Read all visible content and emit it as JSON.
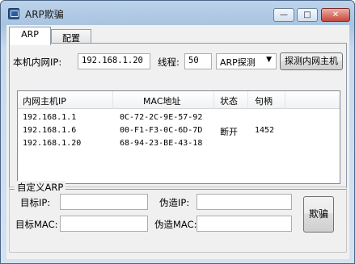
{
  "window": {
    "title": "ARP欺骗",
    "minimize": "—",
    "maximize": "□",
    "close": "✕"
  },
  "tabs": [
    {
      "label": "ARP",
      "active": true
    },
    {
      "label": "配置",
      "active": false
    }
  ],
  "scan": {
    "ip_label": "本机内网IP:",
    "ip_value": "192.168.1.20",
    "threads_label": "线程:",
    "threads_value": "50",
    "mode_value": "ARP探测",
    "scan_button": "探测内网主机"
  },
  "hosts_table": {
    "columns": [
      "内网主机IP",
      "MAC地址",
      "状态",
      "句柄"
    ],
    "rows": [
      {
        "ip": "192.168.1.1",
        "mac": "0C-72-2C-9E-57-92",
        "status": "",
        "handle": ""
      },
      {
        "ip": "192.168.1.6",
        "mac": "00-F1-F3-0C-6D-7D",
        "status": "断开",
        "handle": "1452"
      },
      {
        "ip": "192.168.1.20",
        "mac": "68-94-23-BE-43-18",
        "status": "",
        "handle": ""
      }
    ]
  },
  "custom_arp": {
    "group_title": "自定义ARP",
    "target_ip_label": "目标IP:",
    "target_ip_value": "",
    "spoof_ip_label": "伪造IP:",
    "spoof_ip_value": "",
    "target_mac_label": "目标MAC:",
    "target_mac_value": "",
    "spoof_mac_label": "伪造MAC:",
    "spoof_mac_value": "",
    "spoof_button": "欺骗"
  }
}
